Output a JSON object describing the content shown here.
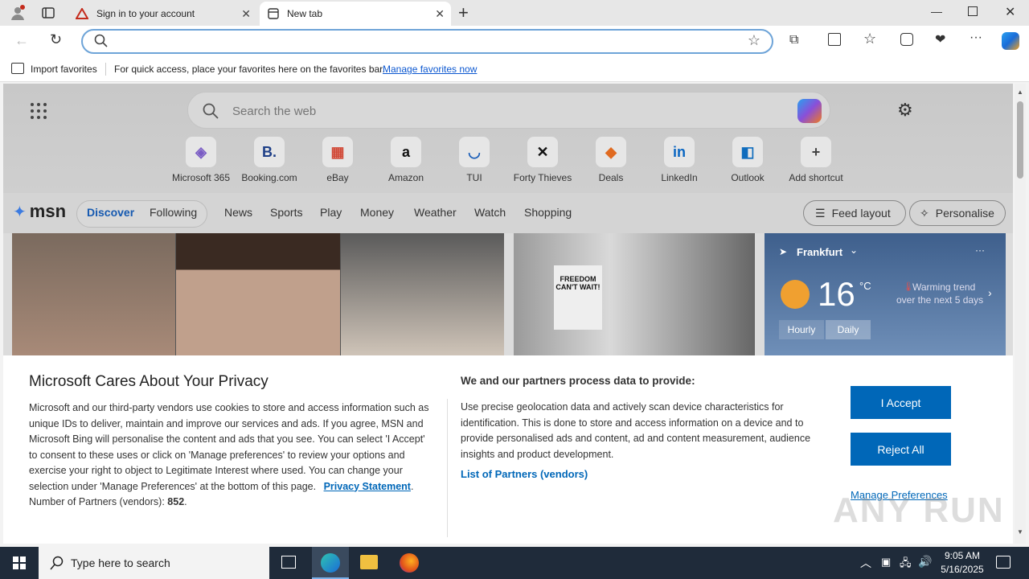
{
  "tabs": [
    {
      "label": "Sign in to your account"
    },
    {
      "label": "New tab"
    }
  ],
  "address": {
    "placeholder": ""
  },
  "favbar": {
    "import_label": "Import favorites",
    "hint": "For quick access, place your favorites here on the favorites bar.",
    "manage_link": "Manage favorites now"
  },
  "search": {
    "placeholder": "Search the web"
  },
  "shortcuts": [
    {
      "label": "Microsoft 365",
      "glyph": "◈",
      "color": "#7a5cc4"
    },
    {
      "label": "Booking.com",
      "glyph": "B.",
      "color": "#1e3f87"
    },
    {
      "label": "eBay",
      "glyph": "▦",
      "color": "#d14836"
    },
    {
      "label": "Amazon",
      "glyph": "a",
      "color": "#111"
    },
    {
      "label": "TUI",
      "glyph": "◡",
      "color": "#1c5fb8"
    },
    {
      "label": "Forty Thieves",
      "glyph": "✕",
      "color": "#111"
    },
    {
      "label": "Deals",
      "glyph": "◆",
      "color": "#e06a20"
    },
    {
      "label": "LinkedIn",
      "glyph": "in",
      "color": "#0a66c2"
    },
    {
      "label": "Outlook",
      "glyph": "◧",
      "color": "#0f6cbd"
    },
    {
      "label": "Add shortcut",
      "glyph": "+",
      "color": "#444"
    }
  ],
  "msn": {
    "logo": "msn",
    "tabs": [
      "Discover",
      "Following"
    ],
    "nav": [
      "News",
      "Sports",
      "Play",
      "Money",
      "Weather",
      "Watch",
      "Shopping"
    ],
    "feed_layout": "Feed layout",
    "personalise": "Personalise"
  },
  "weather": {
    "city": "Frankfurt",
    "temp": "16",
    "unit": "°C",
    "trend": "Warming trend",
    "trend_sub": "over the next 5 days",
    "hourly": "Hourly",
    "daily": "Daily"
  },
  "news_image": {
    "headline": "FREEDOM CAN'T WAIT!"
  },
  "cookie": {
    "title": "Microsoft Cares About Your Privacy",
    "body": "Microsoft and our third-party vendors use cookies to store and access information such as unique IDs to deliver, maintain and improve our services and ads. If you agree, MSN and Microsoft Bing will personalise the content and ads that you see. You can select 'I Accept' to consent to these uses or click on 'Manage preferences' to review your options and exercise your right to object to Legitimate Interest where used.  You can change your selection under 'Manage Preferences' at the bottom of this page.",
    "privacy_link": "Privacy Statement",
    "partners_count_label": "Number of Partners (vendors):",
    "partners_count": "852",
    "right_title": "We and our partners process data to provide:",
    "right_body": "Use precise geolocation data and actively scan device characteristics for identification. This is done to store and access information on a device and to provide personalised ads and content, ad and content measurement, audience insights and product development.",
    "partners_link": "List of Partners (vendors)",
    "accept": "I Accept",
    "reject": "Reject All",
    "manage": "Manage Preferences"
  },
  "taskbar": {
    "search_placeholder": "Type here to search",
    "time": "9:05 AM",
    "date": "5/16/2025"
  },
  "watermark": "ANY RUN"
}
